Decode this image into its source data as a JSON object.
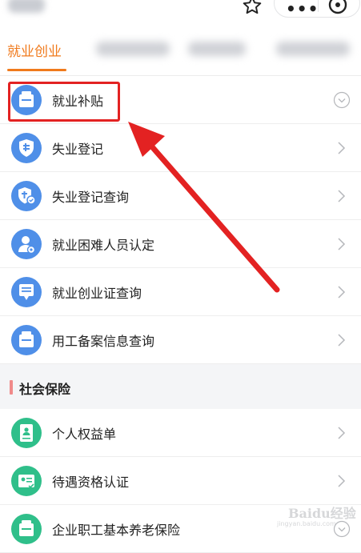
{
  "header": {
    "icons": [
      "star-icon",
      "more-icon",
      "close-icon"
    ],
    "more_label": "•••"
  },
  "tabs": {
    "active_label": "就业创业"
  },
  "employment_items": [
    {
      "label": "就业补贴",
      "icon": "briefcase-icon",
      "trailing": "chevron-circle-down"
    },
    {
      "label": "失业登记",
      "icon": "shield-icon",
      "trailing": "chevron-right"
    },
    {
      "label": "失业登记查询",
      "icon": "shield-search-icon",
      "trailing": "chevron-right"
    },
    {
      "label": "就业困难人员认定",
      "icon": "person-icon",
      "trailing": "chevron-right"
    },
    {
      "label": "就业创业证查询",
      "icon": "certificate-icon",
      "trailing": "chevron-right"
    },
    {
      "label": "用工备案信息查询",
      "icon": "briefcase-icon",
      "trailing": "chevron-right"
    }
  ],
  "social_section": {
    "title": "社会保险"
  },
  "social_items": [
    {
      "label": "个人权益单",
      "icon": "document-icon",
      "trailing": "chevron-right"
    },
    {
      "label": "待遇资格认证",
      "icon": "id-card-icon",
      "trailing": "chevron-right"
    },
    {
      "label": "企业职工基本养老保险",
      "icon": "briefcase-icon",
      "trailing": "chevron-circle-down"
    }
  ],
  "colors": {
    "accent": "#f07a1c",
    "blue_icon": "#4f8fe8",
    "green_icon": "#2fbf8a",
    "annotation_red": "#e32222"
  },
  "watermark": {
    "text": "Baidu经验",
    "sub": "jingyan.baidu.com"
  }
}
